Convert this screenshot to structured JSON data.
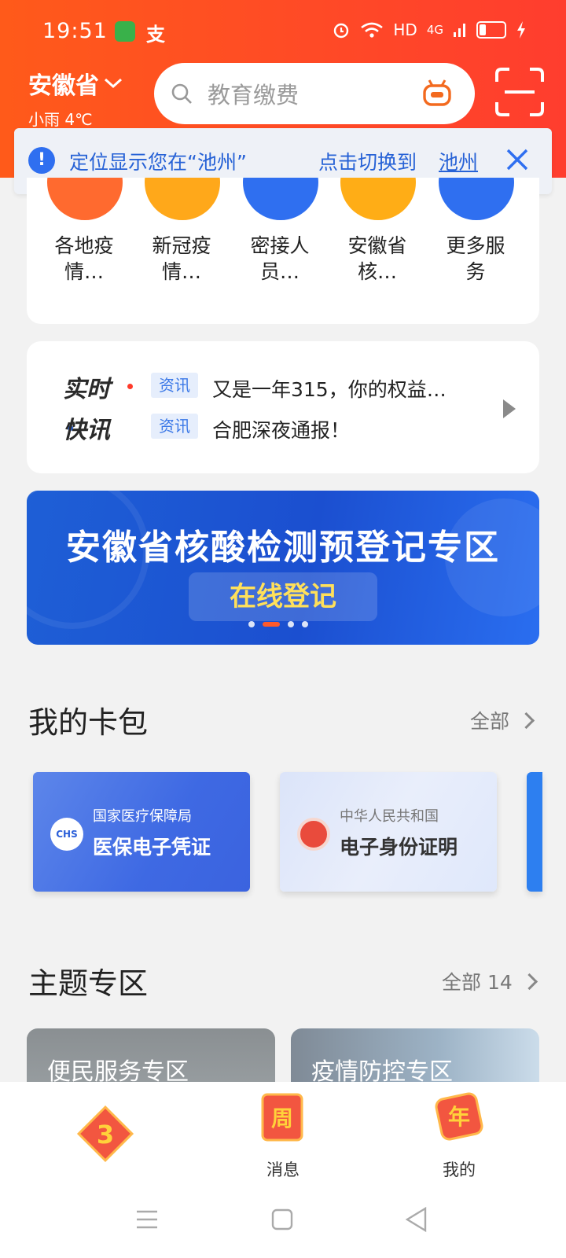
{
  "status_bar": {
    "time": "19:51",
    "app_glyph": "支",
    "network": "HD",
    "signal": "4G"
  },
  "header": {
    "province": "安徽省",
    "weather": "小雨 4℃",
    "search_placeholder": "教育缴费"
  },
  "location_notice": {
    "message": "定位显示您在“池州”",
    "switch_label": "点击切换到",
    "city": "池州"
  },
  "services": [
    {
      "line1": "各地疫",
      "line2": "情…",
      "color": "#ff6a2f"
    },
    {
      "line1": "新冠疫",
      "line2": "情…",
      "color": "#ffa81a"
    },
    {
      "line1": "密接人",
      "line2": "员…",
      "color": "#2f6ff0"
    },
    {
      "line1": "安徽省",
      "line2": "核…",
      "color": "#ffad16"
    },
    {
      "line1": "更多服",
      "line2": "务",
      "color": "#2f6ff0"
    }
  ],
  "news": {
    "brand_line1": "实时",
    "brand_line2": "快讯",
    "items": [
      {
        "tag": "资讯",
        "text": "又是一年315，你的权益…"
      },
      {
        "tag": "资讯",
        "text": "合肥深夜通报！"
      }
    ]
  },
  "banner": {
    "title": "安徽省核酸检测预登记专区",
    "button": "在线登记",
    "active_slide": 2,
    "slide_count": 4
  },
  "card_wallet": {
    "title": "我的卡包",
    "all_label": "全部",
    "cards": [
      {
        "issuer": "国家医疗保障局",
        "name": "医保电子凭证",
        "logo_text": "CHS"
      },
      {
        "issuer": "中华人民共和国",
        "name": "电子身份证明",
        "logo_text": ""
      }
    ]
  },
  "topics": {
    "title": "主题专区",
    "all_label": "全部 14",
    "items": [
      {
        "title": "便民服务专区"
      },
      {
        "title": "疫情防控专区"
      }
    ]
  },
  "tabbar": {
    "items": [
      {
        "label": "",
        "badge": "3"
      },
      {
        "label": "消息",
        "badge": "周"
      },
      {
        "label": "我的",
        "badge": "年"
      }
    ]
  }
}
